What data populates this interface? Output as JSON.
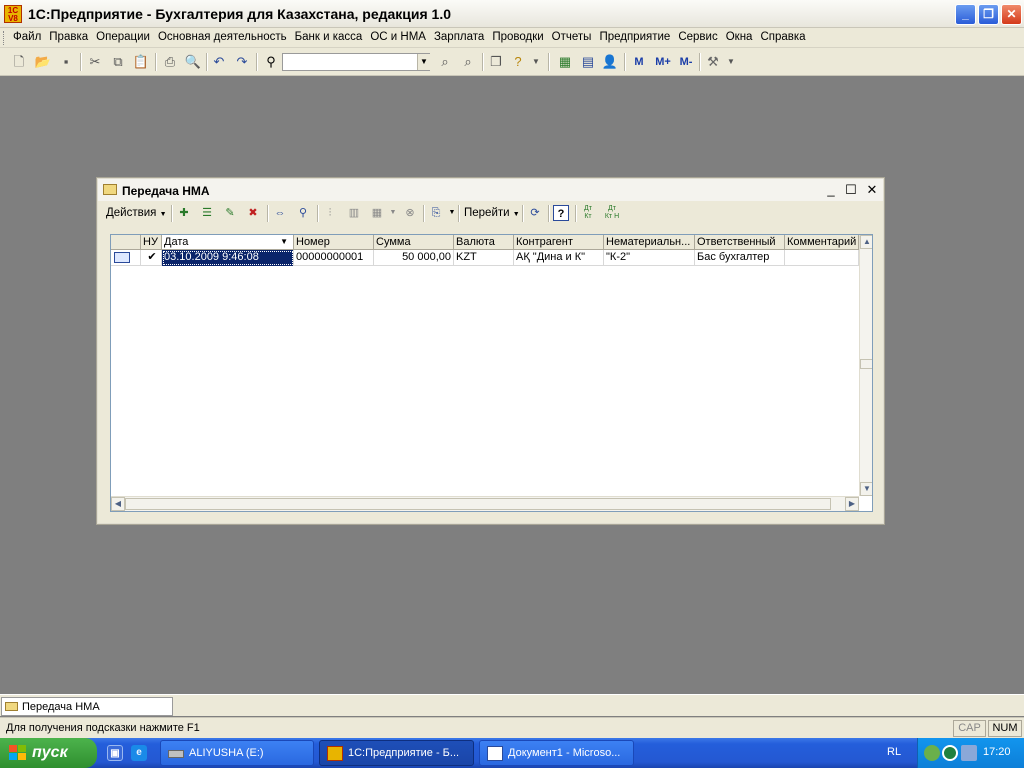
{
  "window": {
    "app_icon_text": "1C\nV8",
    "title": "1С:Предприятие - Бухгалтерия для Казахстана, редакция 1.0"
  },
  "menu": [
    "Файл",
    "Правка",
    "Операции",
    "Основная деятельность",
    "Банк и касса",
    "ОС и НМА",
    "Зарплата",
    "Проводки",
    "Отчеты",
    "Предприятие",
    "Сервис",
    "Окна",
    "Справка"
  ],
  "toolbar": {
    "search_value": "",
    "memory_buttons": [
      "M",
      "M+",
      "M-"
    ]
  },
  "doc_window": {
    "title": "Передача НМА",
    "actions_label": "Действия",
    "goto_label": "Перейти",
    "help_label": "?",
    "dt_kt_label": "Дт Кт",
    "dt_kt_n_label": "Дт Кт Н"
  },
  "grid": {
    "columns": [
      "",
      "НУ",
      "Дата",
      "Номер",
      "Сумма",
      "Валюта",
      "Контрагент",
      "Нематериальн...",
      "Ответственный",
      "Комментарий"
    ],
    "rows": [
      {
        "nu": "✔",
        "date": "03.10.2009 9:46:08",
        "number": "00000000001",
        "sum": "50 000,00",
        "currency": "KZT",
        "counterparty": "АҚ \"Дина и К\"",
        "intangible": "\"К-2\"",
        "responsible": "Бас бухгалтер",
        "comment": ""
      }
    ]
  },
  "mdi_tab": "Передача НМА",
  "status": {
    "hint": "Для получения подсказки нажмите F1",
    "cap": "CAP",
    "num": "NUM"
  },
  "taskbar": {
    "start": "пуск",
    "tasks": [
      "ALIYUSHA (E:)",
      "1С:Предприятие - Б...",
      "Документ1 - Microso..."
    ],
    "lang": "RL",
    "clock": "17:20"
  }
}
